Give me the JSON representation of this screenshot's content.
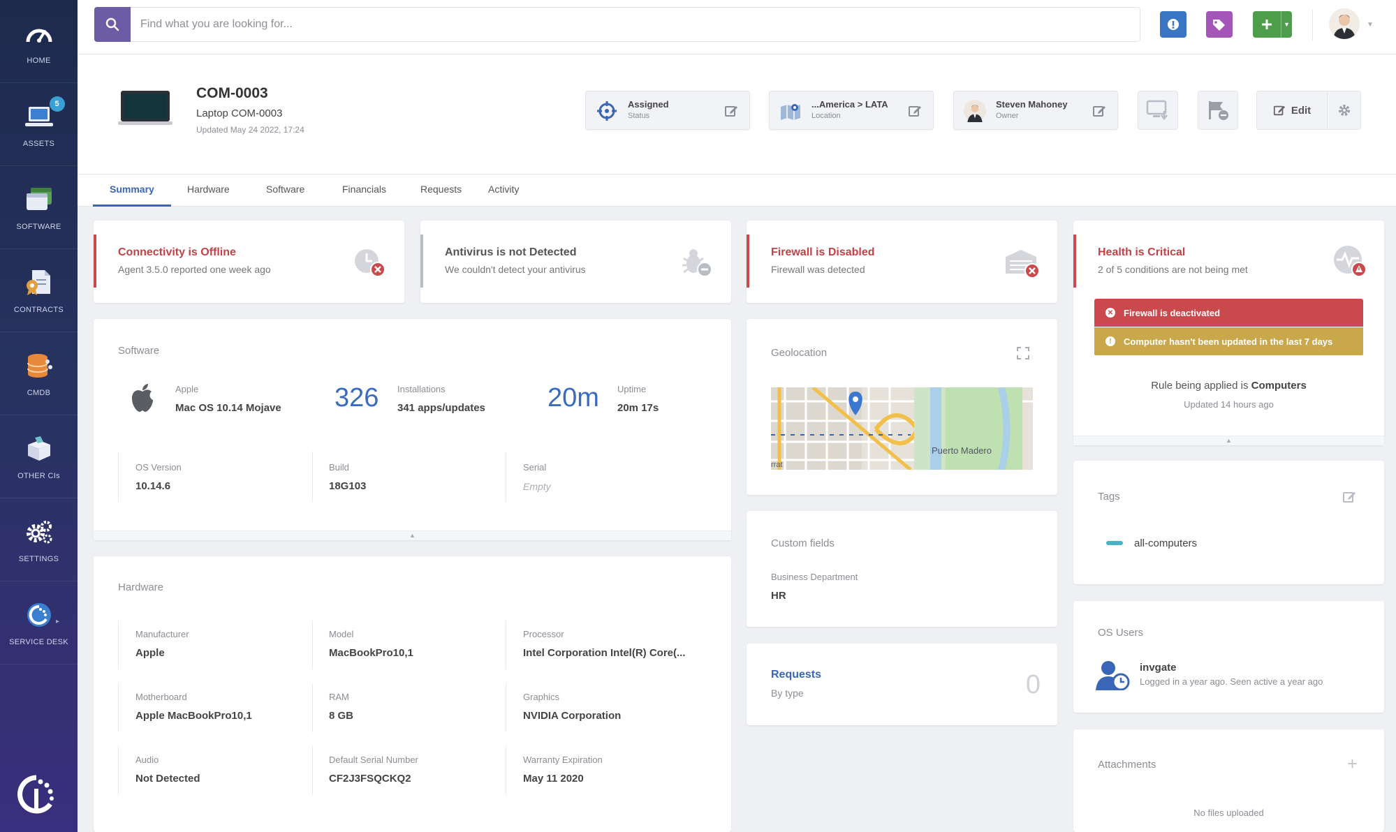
{
  "search": {
    "placeholder": "Find what you are looking for..."
  },
  "nav": [
    {
      "label": "HOME"
    },
    {
      "label": "ASSETS",
      "badge": "5"
    },
    {
      "label": "SOFTWARE"
    },
    {
      "label": "CONTRACTS"
    },
    {
      "label": "CMDB"
    },
    {
      "label": "OTHER CIs"
    },
    {
      "label": "SETTINGS"
    },
    {
      "label": "SERVICE DESK"
    }
  ],
  "asset": {
    "id": "COM-0003",
    "name": "Laptop COM-0003",
    "updated": "Updated May 24 2022, 17:24"
  },
  "status_card": {
    "value": "Assigned",
    "label": "Status"
  },
  "location_card": {
    "value": "...America > LATA",
    "label": "Location"
  },
  "owner_card": {
    "value": "Steven Mahoney",
    "label": "Owner"
  },
  "actions": {
    "edit_label": "Edit"
  },
  "tabs": [
    "Summary",
    "Hardware",
    "Software",
    "Financials",
    "Requests",
    "Activity"
  ],
  "alerts": [
    {
      "title": "Connectivity is Offline",
      "sub": "Agent 3.5.0 reported one week ago"
    },
    {
      "title": "Antivirus is not Detected",
      "sub": "We couldn't detect your antivirus"
    },
    {
      "title": "Firewall is Disabled",
      "sub": "Firewall was detected"
    },
    {
      "title": "Health is Critical",
      "sub": "2 of 5 conditions are not being met"
    }
  ],
  "health": {
    "conditions": [
      "Firewall is deactivated",
      "Computer hasn't been updated in the last 7 days"
    ],
    "rule_prefix": "Rule being applied is",
    "rule_name": "Computers",
    "rule_updated": "Updated 14 hours ago"
  },
  "software": {
    "title": "Software",
    "vendor_label": "Apple",
    "os": "Mac OS 10.14 Mojave",
    "installations_count": "326",
    "installations_label": "Installations",
    "installations_detail": "341 apps/updates",
    "uptime_big": "20m",
    "uptime_label": "Uptime",
    "uptime_detail": "20m 17s",
    "os_version_label": "OS Version",
    "os_version": "10.14.6",
    "build_label": "Build",
    "build": "18G103",
    "serial_label": "Serial",
    "serial": "Empty"
  },
  "hardware": {
    "title": "Hardware",
    "fields": [
      {
        "label": "Manufacturer",
        "value": "Apple"
      },
      {
        "label": "Model",
        "value": "MacBookPro10,1"
      },
      {
        "label": "Processor",
        "value": "Intel Corporation Intel(R) Core(..."
      },
      {
        "label": "Motherboard",
        "value": "Apple MacBookPro10,1"
      },
      {
        "label": "RAM",
        "value": "8 GB"
      },
      {
        "label": "Graphics",
        "value": "NVIDIA Corporation"
      },
      {
        "label": "Audio",
        "value": "Not Detected"
      },
      {
        "label": "Default Serial Number",
        "value": "CF2J3FSQCKQ2"
      },
      {
        "label": "Warranty Expiration",
        "value": "May 11 2020"
      }
    ]
  },
  "geolocation": {
    "title": "Geolocation",
    "map_labels": [
      "Puerto Madero",
      "rrat"
    ]
  },
  "custom_fields": {
    "title": "Custom fields",
    "label": "Business Department",
    "value": "HR"
  },
  "requests": {
    "title": "Requests",
    "sub": "By type",
    "count": "0"
  },
  "tags": {
    "title": "Tags",
    "items": [
      "all-computers"
    ]
  },
  "os_users": {
    "title": "OS Users",
    "name": "invgate",
    "detail": "Logged in a year ago. Seen active a year ago"
  },
  "attachments": {
    "title": "Attachments",
    "empty": "No files uploaded"
  },
  "colors": {
    "accent": "#3a66b7",
    "danger": "#c9494c",
    "warning": "#c9a84c",
    "sidebar": "#27325f"
  }
}
